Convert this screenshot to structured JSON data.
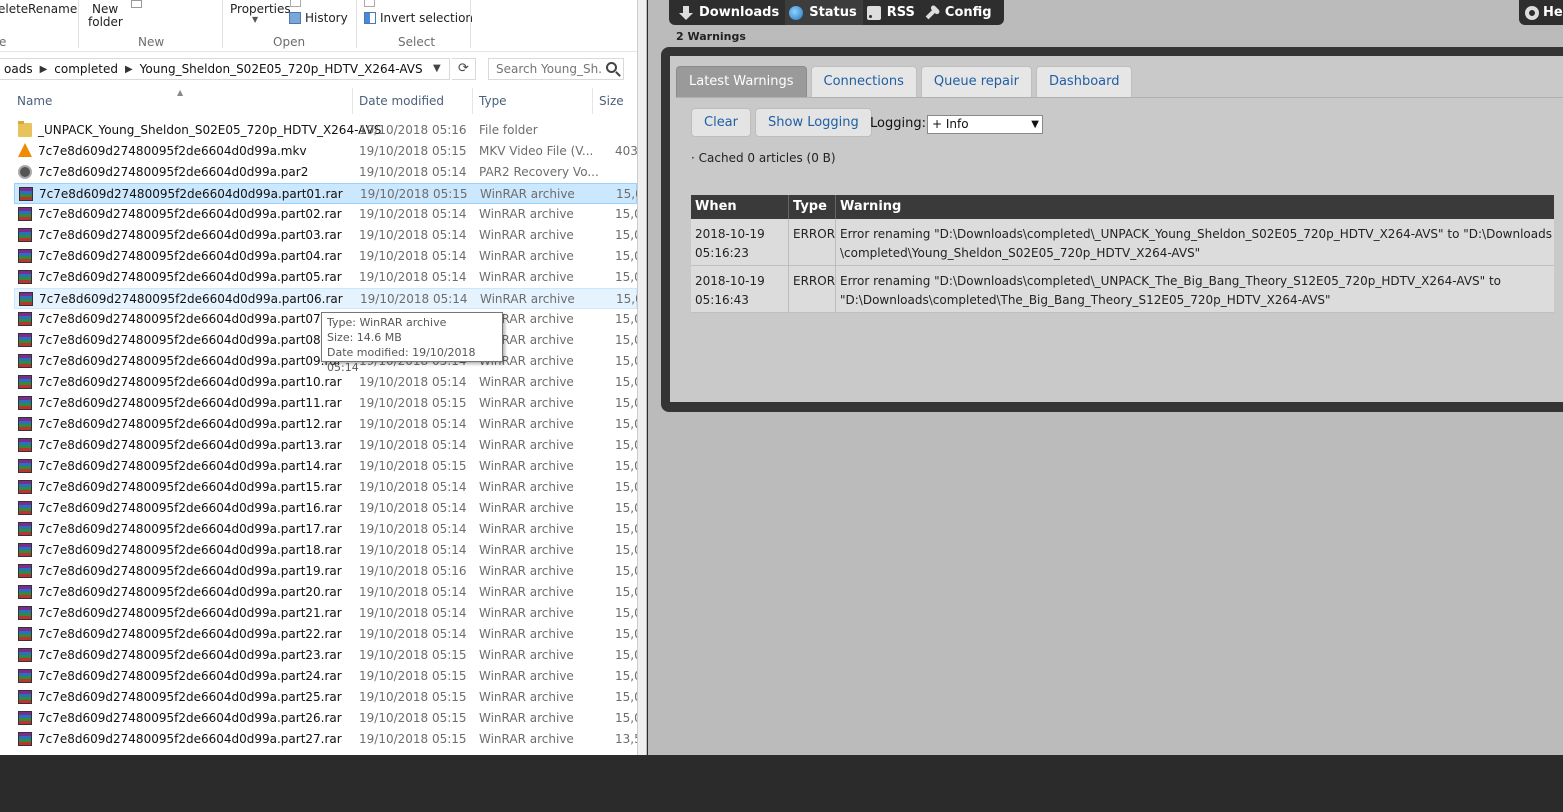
{
  "ribbon": {
    "delete_label": "elete",
    "rename_label": "Rename",
    "new_folder_label_1": "New",
    "new_folder_label_2": "folder",
    "properties_label": "Properties",
    "history_label": "History",
    "invert_selection_label": "Invert selection",
    "group_new": "New",
    "group_open": "Open",
    "group_select": "Select",
    "group_organize_partial": "e"
  },
  "address": {
    "crumbs": [
      "oads",
      "completed",
      "Young_Sheldon_S02E05_720p_HDTV_X264-AVS"
    ]
  },
  "search": {
    "placeholder": "Search Young_Sh..."
  },
  "columns": {
    "name": "Name",
    "date": "Date modified",
    "type": "Type",
    "size": "Size"
  },
  "files": [
    {
      "name": "_UNPACK_Young_Sheldon_S02E05_720p_HDTV_X264-AVS",
      "date": "19/10/2018 05:16",
      "type": "File folder",
      "size": "",
      "icon": "folder-icon"
    },
    {
      "name": "7c7e8d609d27480095f2de6604d0d99a.mkv",
      "date": "19/10/2018 05:15",
      "type": "MKV Video File (V...",
      "size": "403,5",
      "icon": "vlc-icon"
    },
    {
      "name": "7c7e8d609d27480095f2de6604d0d99a.par2",
      "date": "19/10/2018 05:14",
      "type": "PAR2 Recovery Vo...",
      "size": "",
      "icon": "par2-icon"
    },
    {
      "name": "7c7e8d609d27480095f2de6604d0d99a.part01.rar",
      "date": "19/10/2018 05:15",
      "type": "WinRAR archive",
      "size": "15,0",
      "icon": "winrar-icon"
    },
    {
      "name": "7c7e8d609d27480095f2de6604d0d99a.part02.rar",
      "date": "19/10/2018 05:14",
      "type": "WinRAR archive",
      "size": "15,0",
      "icon": "winrar-icon"
    },
    {
      "name": "7c7e8d609d27480095f2de6604d0d99a.part03.rar",
      "date": "19/10/2018 05:14",
      "type": "WinRAR archive",
      "size": "15,0",
      "icon": "winrar-icon"
    },
    {
      "name": "7c7e8d609d27480095f2de6604d0d99a.part04.rar",
      "date": "19/10/2018 05:14",
      "type": "WinRAR archive",
      "size": "15,0",
      "icon": "winrar-icon"
    },
    {
      "name": "7c7e8d609d27480095f2de6604d0d99a.part05.rar",
      "date": "19/10/2018 05:14",
      "type": "WinRAR archive",
      "size": "15,0",
      "icon": "winrar-icon"
    },
    {
      "name": "7c7e8d609d27480095f2de6604d0d99a.part06.rar",
      "date": "19/10/2018 05:14",
      "type": "WinRAR archive",
      "size": "15,0",
      "icon": "winrar-icon"
    },
    {
      "name": "7c7e8d609d27480095f2de6604d0d99a.part07.rar",
      "date": "19/10/2018 05:14",
      "type": "WinRAR archive",
      "size": "15,0",
      "icon": "winrar-icon"
    },
    {
      "name": "7c7e8d609d27480095f2de6604d0d99a.part08.rar",
      "date": "19/10/2018 05:14",
      "type": "WinRAR archive",
      "size": "15,0",
      "icon": "winrar-icon"
    },
    {
      "name": "7c7e8d609d27480095f2de6604d0d99a.part09.rar",
      "date": "19/10/2018 05:14",
      "type": "WinRAR archive",
      "size": "15,0",
      "icon": "winrar-icon"
    },
    {
      "name": "7c7e8d609d27480095f2de6604d0d99a.part10.rar",
      "date": "19/10/2018 05:14",
      "type": "WinRAR archive",
      "size": "15,0",
      "icon": "winrar-icon"
    },
    {
      "name": "7c7e8d609d27480095f2de6604d0d99a.part11.rar",
      "date": "19/10/2018 05:15",
      "type": "WinRAR archive",
      "size": "15,0",
      "icon": "winrar-icon"
    },
    {
      "name": "7c7e8d609d27480095f2de6604d0d99a.part12.rar",
      "date": "19/10/2018 05:14",
      "type": "WinRAR archive",
      "size": "15,0",
      "icon": "winrar-icon"
    },
    {
      "name": "7c7e8d609d27480095f2de6604d0d99a.part13.rar",
      "date": "19/10/2018 05:14",
      "type": "WinRAR archive",
      "size": "15,0",
      "icon": "winrar-icon"
    },
    {
      "name": "7c7e8d609d27480095f2de6604d0d99a.part14.rar",
      "date": "19/10/2018 05:15",
      "type": "WinRAR archive",
      "size": "15,0",
      "icon": "winrar-icon"
    },
    {
      "name": "7c7e8d609d27480095f2de6604d0d99a.part15.rar",
      "date": "19/10/2018 05:14",
      "type": "WinRAR archive",
      "size": "15,0",
      "icon": "winrar-icon"
    },
    {
      "name": "7c7e8d609d27480095f2de6604d0d99a.part16.rar",
      "date": "19/10/2018 05:14",
      "type": "WinRAR archive",
      "size": "15,0",
      "icon": "winrar-icon"
    },
    {
      "name": "7c7e8d609d27480095f2de6604d0d99a.part17.rar",
      "date": "19/10/2018 05:14",
      "type": "WinRAR archive",
      "size": "15,0",
      "icon": "winrar-icon"
    },
    {
      "name": "7c7e8d609d27480095f2de6604d0d99a.part18.rar",
      "date": "19/10/2018 05:14",
      "type": "WinRAR archive",
      "size": "15,0",
      "icon": "winrar-icon"
    },
    {
      "name": "7c7e8d609d27480095f2de6604d0d99a.part19.rar",
      "date": "19/10/2018 05:16",
      "type": "WinRAR archive",
      "size": "15,0",
      "icon": "winrar-icon"
    },
    {
      "name": "7c7e8d609d27480095f2de6604d0d99a.part20.rar",
      "date": "19/10/2018 05:14",
      "type": "WinRAR archive",
      "size": "15,0",
      "icon": "winrar-icon"
    },
    {
      "name": "7c7e8d609d27480095f2de6604d0d99a.part21.rar",
      "date": "19/10/2018 05:14",
      "type": "WinRAR archive",
      "size": "15,0",
      "icon": "winrar-icon"
    },
    {
      "name": "7c7e8d609d27480095f2de6604d0d99a.part22.rar",
      "date": "19/10/2018 05:14",
      "type": "WinRAR archive",
      "size": "15,0",
      "icon": "winrar-icon"
    },
    {
      "name": "7c7e8d609d27480095f2de6604d0d99a.part23.rar",
      "date": "19/10/2018 05:15",
      "type": "WinRAR archive",
      "size": "15,0",
      "icon": "winrar-icon"
    },
    {
      "name": "7c7e8d609d27480095f2de6604d0d99a.part24.rar",
      "date": "19/10/2018 05:15",
      "type": "WinRAR archive",
      "size": "15,0",
      "icon": "winrar-icon"
    },
    {
      "name": "7c7e8d609d27480095f2de6604d0d99a.part25.rar",
      "date": "19/10/2018 05:15",
      "type": "WinRAR archive",
      "size": "15,0",
      "icon": "winrar-icon"
    },
    {
      "name": "7c7e8d609d27480095f2de6604d0d99a.part26.rar",
      "date": "19/10/2018 05:15",
      "type": "WinRAR archive",
      "size": "15,0",
      "icon": "winrar-icon"
    },
    {
      "name": "7c7e8d609d27480095f2de6604d0d99a.part27.rar",
      "date": "19/10/2018 05:15",
      "type": "WinRAR archive",
      "size": "13,5",
      "icon": "winrar-icon"
    }
  ],
  "selected_row": 3,
  "hovered_row": 8,
  "tooltip": {
    "type_line": "Type: WinRAR archive",
    "size_line": "Size: 14.6 MB",
    "date_line": "Date modified: 19/10/2018 05:14"
  },
  "sab": {
    "nav": [
      {
        "label": "Downloads",
        "icon": "download-arrow-icon"
      },
      {
        "label": "Status",
        "icon": "globe-icon"
      },
      {
        "label": "RSS",
        "icon": "rss-icon"
      },
      {
        "label": "Config",
        "icon": "wrench-icon"
      }
    ],
    "help_label": "Hel",
    "warning_count": "2 Warnings",
    "tabs": [
      "Latest Warnings",
      "Connections",
      "Queue repair",
      "Dashboard"
    ],
    "clear_label": "Clear",
    "show_logging_label": "Show Logging",
    "logging_label": "Logging:",
    "logging_value": "+ Info",
    "cached_text": "· Cached 0 articles (0 B)",
    "table_headers": [
      "When",
      "Type",
      "Warning"
    ],
    "warnings": [
      {
        "when_date": "2018-10-19",
        "when_time": "05:16:23",
        "type": "ERROR",
        "line1": "Error renaming \"D:\\Downloads\\completed\\_UNPACK_Young_Sheldon_S02E05_720p_HDTV_X264-AVS\" to \"D:\\Downloads",
        "line2": "\\completed\\Young_Sheldon_S02E05_720p_HDTV_X264-AVS\""
      },
      {
        "when_date": "2018-10-19",
        "when_time": "05:16:43",
        "type": "ERROR",
        "line1": "Error renaming \"D:\\Downloads\\completed\\_UNPACK_The_Big_Bang_Theory_S12E05_720p_HDTV_X264-AVS\" to",
        "line2": "\"D:\\Downloads\\completed\\The_Big_Bang_Theory_S12E05_720p_HDTV_X264-AVS\""
      }
    ]
  }
}
